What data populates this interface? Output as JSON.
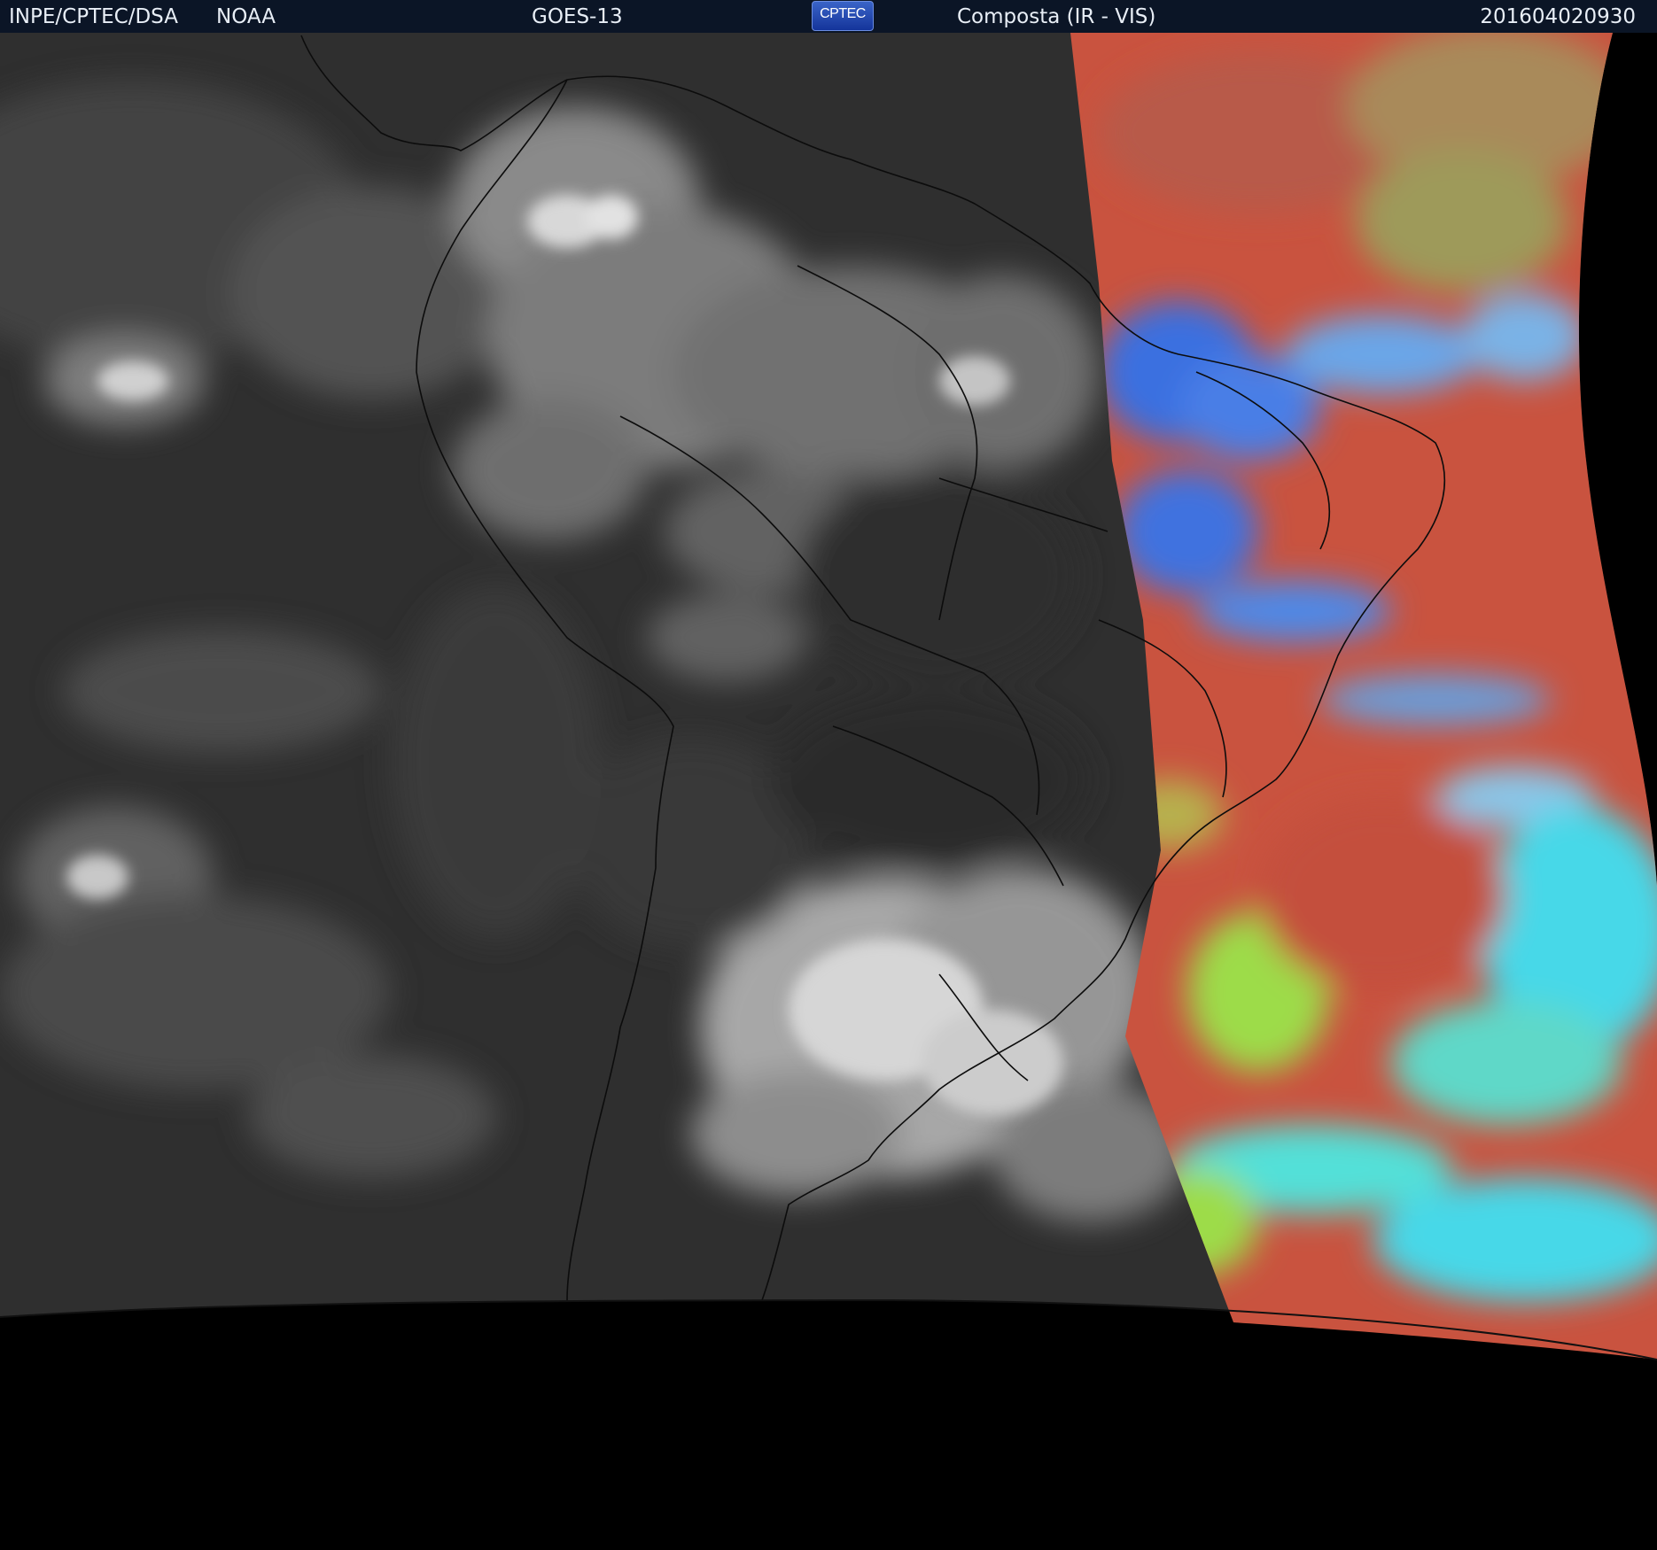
{
  "header": {
    "agency": "INPE/CPTEC/DSA",
    "partner": "NOAA",
    "satellite": "GOES-13",
    "logo_text": "CPTEC",
    "product": "Composta (IR - VIS)",
    "timestamp": "201604020930"
  },
  "colors": {
    "header_background": "#0b1526",
    "header_text": "#e8eef6",
    "infrared_background": "#333333",
    "visible_red": "#c9533f",
    "visible_blue": "#3a6fe0",
    "visible_cyan": "#46d8e8",
    "visible_green": "#9ddc4a",
    "space": "#000000"
  }
}
